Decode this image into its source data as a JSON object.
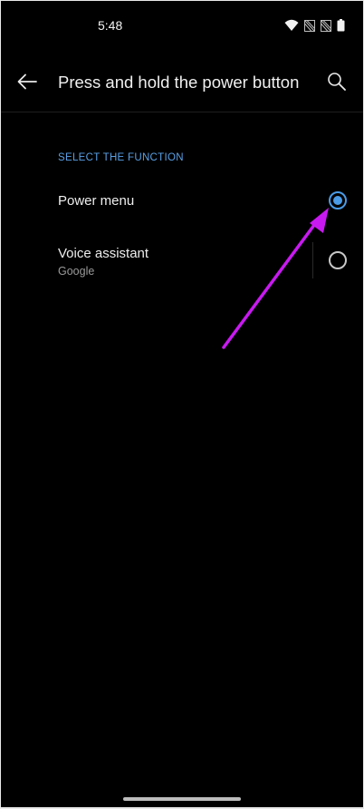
{
  "status_bar": {
    "time": "5:48",
    "icons": [
      "wifi-icon",
      "signal-no-sim-icon",
      "signal-no-sim-icon",
      "battery-icon"
    ]
  },
  "app_bar": {
    "title": "Press and hold the power button",
    "back_icon": "arrow-left-icon",
    "search_icon": "search-icon"
  },
  "section": {
    "header": "SELECT THE FUNCTION",
    "options": [
      {
        "title": "Power menu",
        "subtitle": "",
        "selected": true
      },
      {
        "title": "Voice assistant",
        "subtitle": "Google",
        "selected": false
      }
    ]
  },
  "colors": {
    "background": "#000000",
    "accent": "#4a9be8",
    "annotation": "#c81af0",
    "text_primary": "#eeeeee",
    "text_secondary": "#9a9a9a"
  }
}
